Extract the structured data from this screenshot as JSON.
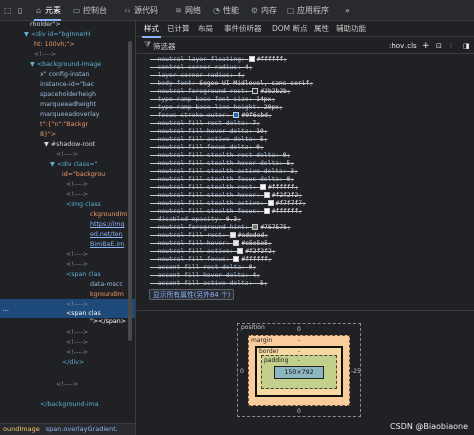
{
  "topbar": {
    "element_label": "元素",
    "tabs": [
      "控制台",
      "源代码",
      "网络",
      "性能",
      "内存",
      "应用程序"
    ],
    "more": "»"
  },
  "icons": {
    "inspect": "inspect-icon",
    "device": "device-toolbar-icon",
    "elements": "elements-icon",
    "console": "console-icon",
    "sources": "sources-icon",
    "network": "network-icon",
    "performance": "performance-icon",
    "memory": "memory-icon",
    "application": "application-icon",
    "filter": "filter-icon",
    "add": "add-rule-icon"
  },
  "dom": {
    "lines": [
      "rholder\">",
      "▼ <div id=\"bgInnerH",
      "ht: 100vh;\">",
      "<!---->",
      "▼ <background-image",
      "x\" config-instan",
      "instance-id=\"bac",
      "spaceholderheigh",
      "marqueeadheight",
      "marqueeadoverlay",
      "t\":{\"n\":\"Backgr",
      "8}\">",
      "▼ #shadow-root",
      "<!---->",
      "▼ <div class=\"",
      "id=\"backgrou",
      "<!---->",
      "<!---->",
      "<img class",
      "ckgroundIm",
      "https://img",
      "ed.net/ten",
      "BimBaE.im",
      "<!---->",
      "<!---->",
      "<span clas",
      "data-mscc",
      "kgroundIm",
      "<!---->",
      "<span clas",
      "\"></span>",
      "<!---->",
      "<!---->",
      "<!---->",
      "</div>",
      "<!---->",
      "</background-ima"
    ],
    "breadcrumbs": [
      "oundImage",
      "span.overlayGradient."
    ],
    "selected_dots": "…"
  },
  "styles": {
    "subtabs": [
      "样式",
      "已计算",
      "布局",
      "事件侦听器",
      "DOM 断点",
      "属性",
      "辅助功能"
    ],
    "filter_placeholder": "筛选器",
    "hov": ":hov",
    "cls": ".cls",
    "props": [
      {
        "name": "--neutral-layer-floating",
        "value": "#ffffff",
        "color": "#ffffff"
      },
      {
        "name": "--control-corner-radius",
        "value": "4"
      },
      {
        "name": "--layer-corner-radius",
        "value": "4"
      },
      {
        "name": "--body-font",
        "value": "Segoe UI Midlevel, sans-serif"
      },
      {
        "name": "--neutral-foreground-rest",
        "value": "#2b2b2b",
        "color": "#2b2b2b"
      },
      {
        "name": "--type-ramp-base-font-size",
        "value": "14px"
      },
      {
        "name": "--type-ramp-base-line-height",
        "value": "20px"
      },
      {
        "name": "--focus-stroke-outer",
        "value": "#0f6cbd",
        "color": "#0f6cbd"
      },
      {
        "name": "--neutral-fill-rest-delta",
        "value": "7"
      },
      {
        "name": "--neutral-fill-hover-delta",
        "value": "10"
      },
      {
        "name": "--neutral-fill-active-delta",
        "value": "5"
      },
      {
        "name": "--neutral-fill-focus-delta",
        "value": "0"
      },
      {
        "name": "--neutral-fill-stealth-rest-delta",
        "value": "0"
      },
      {
        "name": "--neutral-fill-stealth-hover-delta",
        "value": "5"
      },
      {
        "name": "--neutral-fill-stealth-active-delta",
        "value": "3"
      },
      {
        "name": "--neutral-fill-stealth-focus-delta",
        "value": "0"
      },
      {
        "name": "--neutral-fill-stealth-rest",
        "value": "#ffffff",
        "color": "#ffffff"
      },
      {
        "name": "--neutral-fill-stealth-hover",
        "value": "#f2f2f2",
        "color": "#f2f2f2"
      },
      {
        "name": "--neutral-fill-stealth-active",
        "value": "#f7f7f7",
        "color": "#f7f7f7"
      },
      {
        "name": "--neutral-fill-stealth-focus",
        "value": "#ffffff",
        "color": "#ffffff"
      },
      {
        "name": "--disabled-opacity",
        "value": "0.3"
      },
      {
        "name": "--neutral-foreground-hint",
        "value": "#757575",
        "color": "#757575"
      },
      {
        "name": "--neutral-fill-rest",
        "value": "#ededed",
        "color": "#ededed"
      },
      {
        "name": "--neutral-fill-hover",
        "value": "#e5e5e5",
        "color": "#e5e5e5"
      },
      {
        "name": "--neutral-fill-active",
        "value": "#f2f2f2",
        "color": "#f2f2f2"
      },
      {
        "name": "--neutral-fill-focus",
        "value": "#ffffff",
        "color": "#ffffff"
      },
      {
        "name": "--accent-fill-rest-delta",
        "value": "0"
      },
      {
        "name": "--accent-fill-hover-delta",
        "value": "4"
      },
      {
        "name": "--accent-fill-active-delta",
        "value": "-5"
      }
    ],
    "show_all": "显示所有属性(另外84 个)"
  },
  "box_model": {
    "position_label": "position",
    "position_top": "0",
    "position_bottom": "0",
    "position_left": "0",
    "position_right": "-25",
    "margin_label": "margin",
    "margin_value": "-",
    "border_label": "border",
    "border_value": "-",
    "padding_label": "padding",
    "padding_value": "-",
    "content": "150×792"
  },
  "watermark": "CSDN @Biaobiaone"
}
